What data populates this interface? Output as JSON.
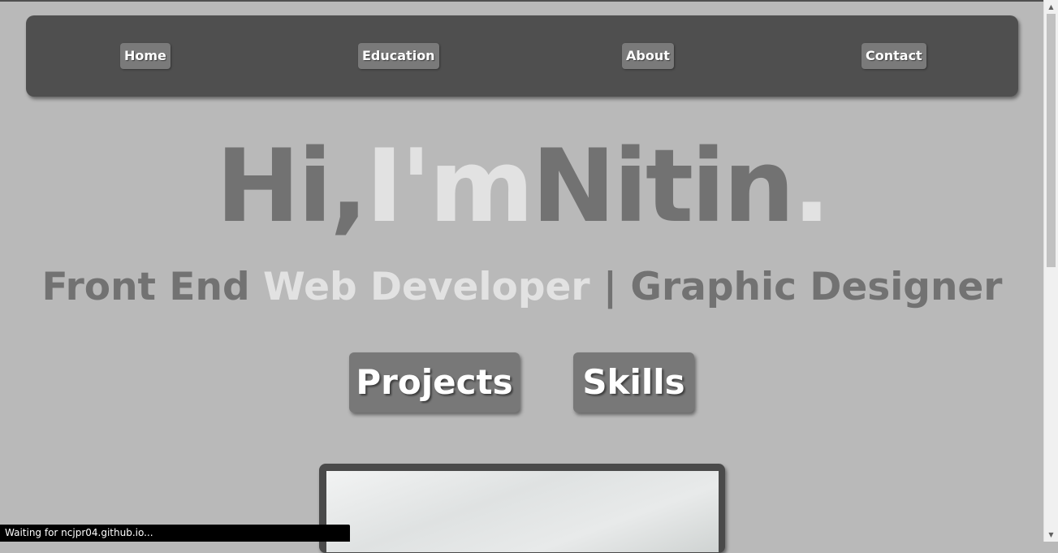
{
  "nav": {
    "items": [
      {
        "label": "Home"
      },
      {
        "label": "Education"
      },
      {
        "label": "About"
      },
      {
        "label": "Contact"
      }
    ]
  },
  "hero": {
    "part1": "Hi,",
    "part2": "I'm",
    "part3": "Nitin",
    "part4": "."
  },
  "subtitle": {
    "part1": "Front End ",
    "part2": "Web Developer",
    "part3": " | Graphic Designer"
  },
  "actions": {
    "projects_label": "Projects",
    "skills_label": "Skills"
  },
  "status": {
    "text": "Waiting for ncjpr04.github.io..."
  },
  "scrollbar": {
    "up_glyph": "▲",
    "down_glyph": "▼"
  },
  "colors": {
    "background": "#b9b9b9",
    "nav_background": "#4f4f4f",
    "button": "#787878",
    "text_dark": "#727272",
    "text_light": "#e2e2e2"
  }
}
